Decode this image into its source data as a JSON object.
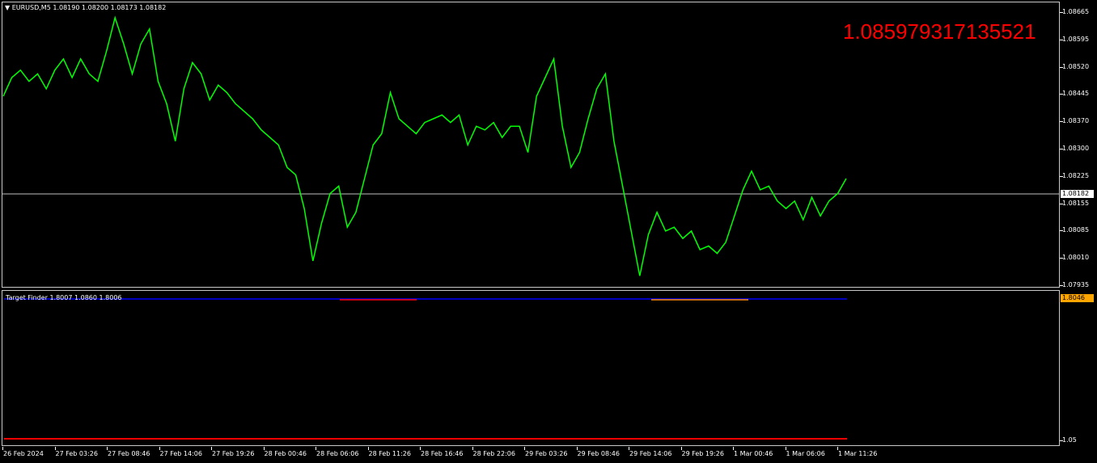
{
  "chart_header": {
    "symbol_tf": "EURUSD,M5",
    "ohlc": "1.08190 1.08200 1.08173 1.08182"
  },
  "big_value": "1.085979317135521",
  "current_price": "1.08182",
  "colors": {
    "price_line": "#00ff00",
    "big_value": "#ff0000",
    "indicator_upper": "#0000ff",
    "indicator_lower": "#ff0000",
    "indicator_box": "#ffa500"
  },
  "price_scale": [
    "1.08665",
    "1.08595",
    "1.08520",
    "1.08445",
    "1.08370",
    "1.08300",
    "1.08225",
    "1.08155",
    "1.08085",
    "1.08010",
    "1.07935"
  ],
  "indicator": {
    "label": "Target Finder 1.8007 1.0860 1.8006",
    "current": "1.8046",
    "scale_low": "1.05"
  },
  "time_labels": [
    "26 Feb 2024",
    "27 Feb 03:26",
    "27 Feb 08:46",
    "27 Feb 14:06",
    "27 Feb 19:26",
    "28 Feb 00:46",
    "28 Feb 06:06",
    "28 Feb 11:26",
    "28 Feb 16:46",
    "28 Feb 22:06",
    "29 Feb 03:26",
    "29 Feb 08:46",
    "29 Feb 14:06",
    "29 Feb 19:26",
    "1 Mar 00:46",
    "1 Mar 06:06",
    "1 Mar 11:26"
  ],
  "chart_data": {
    "type": "line",
    "series": [
      {
        "values": [
          1.0844,
          1.0849,
          1.0851,
          1.0848,
          1.085,
          1.0846,
          1.0851,
          1.0854,
          1.0849,
          1.0854,
          1.085,
          1.0848,
          1.0856,
          1.0865,
          1.0858,
          1.085,
          1.0858,
          1.0862,
          1.0848,
          1.0842,
          1.0832,
          1.0846,
          1.0853,
          1.085,
          1.0843,
          1.0847,
          1.0845,
          1.0842,
          1.084,
          1.0838,
          1.0835,
          1.0833,
          1.0831,
          1.0825,
          1.0823,
          1.0814,
          1.08,
          1.081,
          1.0818,
          1.082,
          1.0809,
          1.0813,
          1.0822,
          1.0831,
          1.0834,
          1.0845,
          1.0838,
          1.0836,
          1.0834,
          1.0837,
          1.0838,
          1.0839,
          1.0837,
          1.0839,
          1.0831,
          1.0836,
          1.0835,
          1.0837,
          1.0833,
          1.0836,
          1.0836,
          1.0829,
          1.0844,
          1.0849,
          1.0854,
          1.0836,
          1.0825,
          1.0829,
          1.0838,
          1.0846,
          1.085,
          1.0832,
          1.082,
          1.0808,
          1.0796,
          1.0807,
          1.0813,
          1.0808,
          1.0809,
          1.0806,
          1.0808,
          1.0803,
          1.0804,
          1.0802,
          1.0805,
          1.0812,
          1.0819,
          1.0824,
          1.0819,
          1.082,
          1.0816,
          1.0814,
          1.0816,
          1.0811,
          1.0817,
          1.0812,
          1.0816,
          1.0818,
          1.0822
        ]
      }
    ],
    "ylim": [
      1.07935,
      1.08665
    ]
  }
}
